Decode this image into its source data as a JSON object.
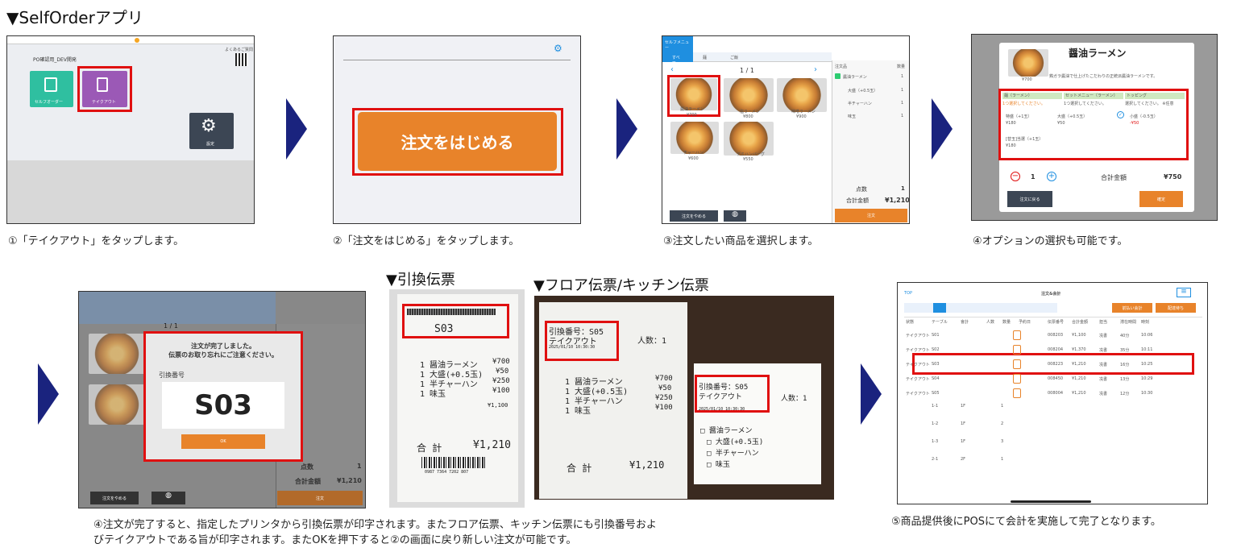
{
  "title": "▼SelfOrderアプリ",
  "captions": {
    "c1": "①「テイクアウト」をタップします。",
    "c2": "②「注文をはじめる」をタップします。",
    "c3": "③注文したい商品を選択します。",
    "c4": "④オプションの選択も可能です。",
    "c5a": "④注文が完了すると、指定したプリンタから引換伝票が印字されます。またフロア伝票、キッチン伝票にも引換番号およ",
    "c5b": "びテイクアウトである旨が印字されます。またOKを押下すると②の画面に戻り新しい注文が可能です。",
    "c6": "⑤商品提供後にPOSにて会計を実施して完了となります。"
  },
  "subheads": {
    "exchange": "▼引換伝票",
    "floor": "▼フロア伝票/キッチン伝票"
  },
  "s1": {
    "store": "PO確認用_DEV開発",
    "selforder": "セルフオーダー",
    "takeout": "テイクアウト",
    "settings": "設定",
    "qr_label": "よくあるご質問"
  },
  "s2": {
    "start": "注文をはじめる"
  },
  "s3": {
    "menu": "セルフメニュー",
    "tabs": [
      "すべて",
      "麺",
      "ご飯"
    ],
    "page": "1 / 1",
    "items": [
      {
        "name": "醤油ラーメン",
        "price": "¥700"
      },
      {
        "name": "塩ラーメン",
        "price": "¥800"
      },
      {
        "name": "味噌ラーメン",
        "price": "¥900"
      },
      {
        "name": "チャーハン",
        "price": "¥600"
      },
      {
        "name": "デミハンバーグ",
        "price": "¥550"
      }
    ],
    "cart_header": [
      "注文品",
      "数量"
    ],
    "cart": [
      {
        "name": "醤油ラーメン",
        "qty": "1"
      },
      {
        "name": "大盛（+0.5玉）",
        "qty": "1"
      },
      {
        "name": "半チャーハン",
        "qty": "1"
      },
      {
        "name": "味玉",
        "qty": "1"
      }
    ],
    "count_label": "点数",
    "count": "1",
    "total_label": "合計金額",
    "total": "¥1,210",
    "cancel": "注文をやめる",
    "order": "注文"
  },
  "s4": {
    "title": "醤油ラーメン",
    "price": "¥700",
    "desc": "鶏ガラ醤油で仕上げたこだわりの正統派醤油ラーメンです。",
    "groups": [
      "麺（ラーメン）",
      "セットメニュー（ラーメン）",
      "トッピング"
    ],
    "notes": [
      "1つ選択してください。",
      "1つ選択してください。",
      "選択してください。 ※任意"
    ],
    "opts": [
      {
        "name": "特盛（+1玉）",
        "price": "¥180"
      },
      {
        "name": "大盛（+0.5玉）",
        "price": "¥50"
      },
      {
        "name": "小盛（-0.5玉）",
        "price": "-¥50"
      },
      {
        "name": "[替玉]当選（+1玉）",
        "price": "¥180"
      }
    ],
    "qty": "1",
    "total_label": "合計金額",
    "total": "¥750",
    "back": "注文に戻る",
    "confirm": "確定"
  },
  "s5": {
    "msg1": "注文が完了しました。",
    "msg2": "伝票のお取り忘れにご注意ください。",
    "label": "引換番号",
    "number": "S03",
    "ok": "OK",
    "count_label": "点数",
    "count": "1",
    "total_label": "合計金額",
    "total": "¥1,210",
    "cancel": "注文をやめる",
    "order": "注文",
    "page": "1 / 1"
  },
  "r1": {
    "num": "S03",
    "lines": [
      "1 醤油ラーメン",
      "1 大盛(+0.5玉)",
      "1 半チャーハン",
      "1 味玉"
    ],
    "prices": [
      "¥700",
      "¥50",
      "¥250",
      "¥100"
    ],
    "subtotal": "¥1,100",
    "total_label": "合 計",
    "total": "¥1,210",
    "barcode": "0987 7364 7202 807"
  },
  "r2": {
    "num": "引換番号：S05",
    "kind": "テイクアウト",
    "date": "2025/01/10 10:30:30",
    "people": "人数：1",
    "lines": [
      "1 醤油ラーメン",
      "1 大盛(+0.5玉)",
      "1 半チャーハン",
      "1 味玉"
    ],
    "prices": [
      "¥700",
      "¥50",
      "¥250",
      "¥100"
    ],
    "total_label": "合 計",
    "total": "¥1,210"
  },
  "r3": {
    "num": "引換番号：S05",
    "kind": "テイクアウト",
    "date": "2025/01/10 10:30:30",
    "people": "人数：1",
    "lines": [
      "□ 醤油ラーメン",
      "□ 大盛(+0.5玉)",
      "□ 半チャーハン",
      "□ 味玉"
    ]
  },
  "pos": {
    "top": "TOP",
    "header": "注文&会計",
    "btn1": "前払い会計",
    "btn2": "配達待ち",
    "cols": [
      "状態",
      "テーブル",
      "會計",
      "人数",
      "数量",
      "予約日",
      "伝票番号",
      "合計金額",
      "担当",
      "滞在時間",
      "時刻"
    ],
    "rows": [
      [
        "テイクアウト",
        "S01",
        "",
        "",
        "",
        "",
        "008203",
        "¥1,100",
        "冼書",
        "40分",
        "10:06"
      ],
      [
        "テイクアウト",
        "S02",
        "",
        "",
        "",
        "",
        "008204",
        "¥1,370",
        "冼書",
        "35分",
        "10:11"
      ],
      [
        "テイクアウト",
        "S03",
        "",
        "",
        "",
        "",
        "008223",
        "¥1,210",
        "冼書",
        "16分",
        "10:25"
      ],
      [
        "テイクアウト",
        "S04",
        "",
        "",
        "",
        "",
        "008450",
        "¥1,210",
        "冼書",
        "13分",
        "10:29"
      ],
      [
        "テイクアウト",
        "S05",
        "",
        "",
        "",
        "",
        "008004",
        "¥1,210",
        "冼書",
        "12分",
        "10:30"
      ]
    ],
    "tables": [
      [
        "1-1",
        "1F",
        "1"
      ],
      [
        "1-2",
        "1F",
        "2"
      ],
      [
        "1-3",
        "1F",
        "3"
      ],
      [
        "2-1",
        "2F",
        "1"
      ]
    ]
  }
}
